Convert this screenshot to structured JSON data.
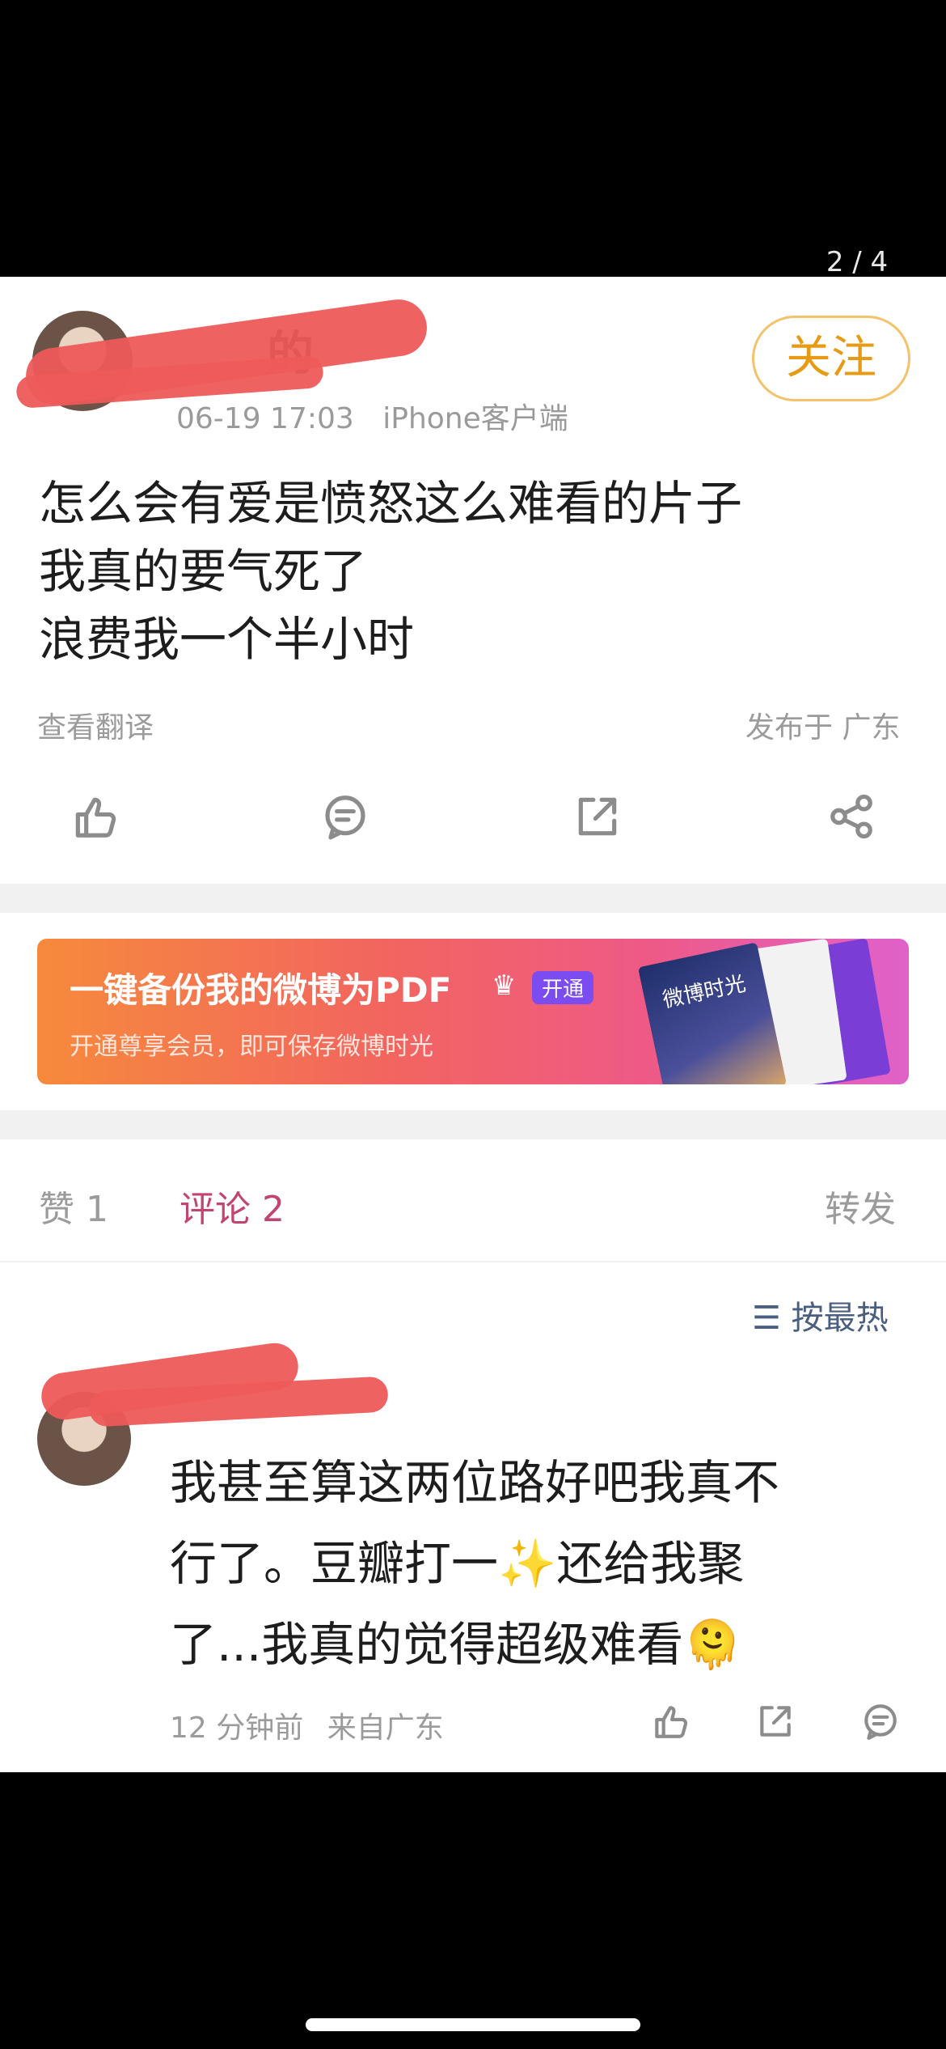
{
  "viewer": {
    "page_counter": "2 / 4"
  },
  "post": {
    "username_visible": "的",
    "timestamp": "06-19 17:03",
    "source": "iPhone客户端",
    "follow_label": "关注",
    "lines": [
      "怎么会有爱是愤怒这么难看的片子",
      "我真的要气死了",
      "浪费我一个半小时"
    ],
    "translate_label": "查看翻译",
    "location_label": "发布于 广东",
    "actions": [
      "like-icon",
      "comment-icon",
      "share-out-icon",
      "share-nodes-icon"
    ]
  },
  "banner": {
    "title": "一键备份我的微博为PDF",
    "vip_label": "开通",
    "subtitle": "开通尊享会员，即可保存微博时光",
    "book_title": "微博时光",
    "colors": {
      "start": "#f68a3c",
      "mid": "#f2655f",
      "end": "#e061c9"
    }
  },
  "tabs": {
    "likes": "赞 1",
    "comments": "评论 2",
    "reposts": "转发"
  },
  "sort_label": "按最热",
  "comment": {
    "lines": [
      "我甚至算这两位路好吧我真不",
      "行了。豆瓣打一✨还给我聚",
      "了...我真的觉得超级难看🫠"
    ],
    "time": "12 分钟前",
    "location": "来自广东",
    "actions": [
      "like-icon",
      "share-out-icon",
      "reply-icon"
    ]
  },
  "colors": {
    "accent": "#e79b14",
    "active_tab": "#c2456d",
    "sort": "#4a5f80"
  }
}
